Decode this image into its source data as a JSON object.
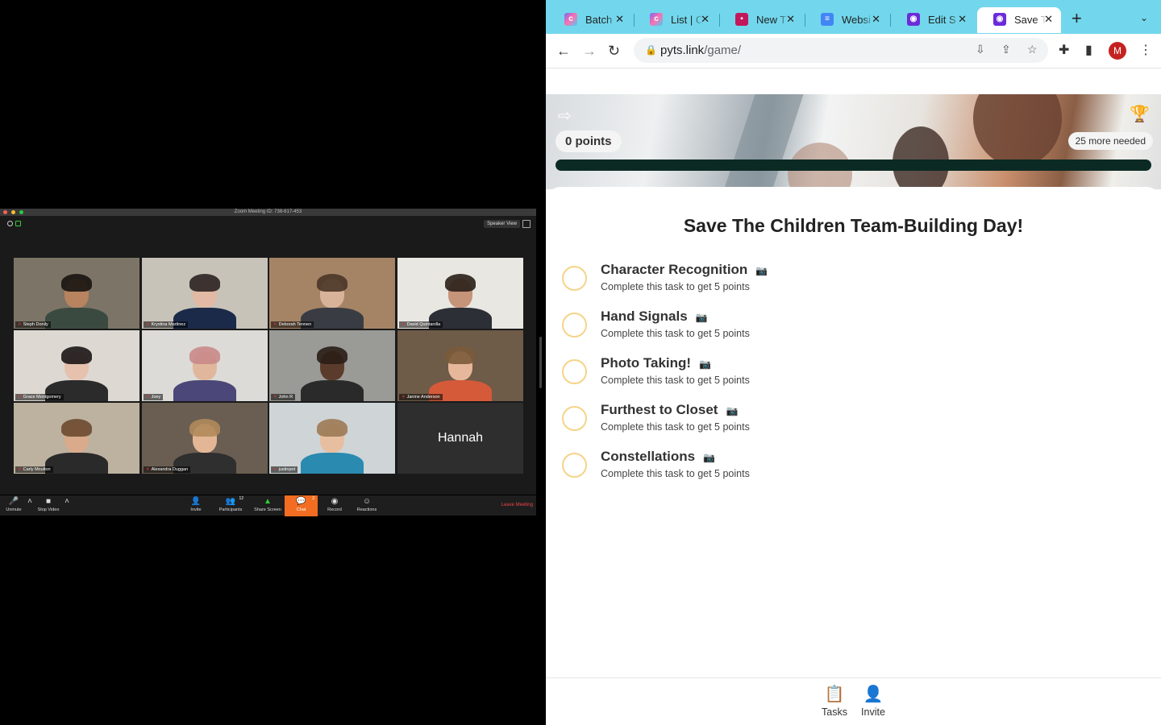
{
  "zoom": {
    "title": "Zoom Meeting ID: 738-617-453",
    "view_label": "Speaker View",
    "participants": [
      {
        "name": "Steph Donily",
        "bg": "#7c7466",
        "skin": "#b8835f",
        "shirt": "#3b4a40",
        "hair": "#1a1412"
      },
      {
        "name": "Krystina Martinez",
        "bg": "#c8c3b8",
        "skin": "#e1b9a4",
        "shirt": "#1c2a4a",
        "hair": "#2b2422"
      },
      {
        "name": "Deborah Tennen",
        "bg": "#a58466",
        "skin": "#d8b39a",
        "shirt": "#3a3c44",
        "hair": "#4a3526"
      },
      {
        "name": "David Quintanilla",
        "bg": "#e9e7e2",
        "skin": "#c69479",
        "shirt": "#2d2f36",
        "hair": "#2a1f19"
      },
      {
        "name": "Grace Montgomery",
        "bg": "#ddd9d2",
        "skin": "#e6c1ae",
        "shirt": "#2b2b2b",
        "hair": "#1a1616"
      },
      {
        "name": "Joey",
        "bg": "#dcdbd7",
        "skin": "#e0b79c",
        "shirt": "#4b4778",
        "hair": "#c98a8a"
      },
      {
        "name": "John R",
        "bg": "#9a9a96",
        "skin": "#5b3c2c",
        "shirt": "#2a2a2a",
        "hair": "#2a1d16"
      },
      {
        "name": "Janine Anderson",
        "bg": "#6e5b48",
        "skin": "#e7b79b",
        "shirt": "#d45a3a",
        "hair": "#7a5a3a"
      },
      {
        "name": "Carly Moulton",
        "bg": "#bdb2a0",
        "skin": "#d9aa8c",
        "shirt": "#2a2a2a",
        "hair": "#6b4a30"
      },
      {
        "name": "Alexandra Duggan",
        "bg": "#6a5e52",
        "skin": "#e3b796",
        "shirt": "#2f2f2f",
        "hair": "#b08a5a"
      },
      {
        "name": "justinpot",
        "bg": "#cfd4d6",
        "skin": "#e8bea0",
        "shirt": "#2a8ab0",
        "hair": "#9c7a55"
      },
      {
        "name": "Hannah"
      }
    ],
    "toolbar": {
      "unmute": "Unmute",
      "stop_video": "Stop Video",
      "invite": "Invite",
      "participants": "Participants",
      "participants_count": "12",
      "share_screen": "Share Screen",
      "chat": "Chat",
      "chat_count": "2",
      "record": "Record",
      "reactions": "Reactions",
      "leave": "Leave Meeting"
    }
  },
  "browser": {
    "tabs": [
      {
        "label": "Batch",
        "favicon": "clickup"
      },
      {
        "label": "List | C",
        "favicon": "clickup"
      },
      {
        "label": "New T",
        "favicon": "app"
      },
      {
        "label": "Websi",
        "favicon": "docs"
      },
      {
        "label": "Edit S",
        "favicon": "goosechase"
      },
      {
        "label": "Save T",
        "favicon": "goosechase",
        "active": true
      }
    ],
    "url_host": "pyts.link",
    "url_path": "/game/",
    "profile_initial": "M"
  },
  "game": {
    "points": "0 points",
    "needed": "25 more needed",
    "progress": 0,
    "title": "Save The Children Team-Building Day!",
    "tasks": [
      {
        "name": "Character Recognition",
        "description": "Complete this task to get 5 points"
      },
      {
        "name": "Hand Signals",
        "description": "Complete this task to get 5 points"
      },
      {
        "name": "Photo Taking!",
        "description": "Complete this task to get 5 points"
      },
      {
        "name": "Furthest to Closet",
        "description": "Complete this task to get 5 points"
      },
      {
        "name": "Constellations",
        "description": "Complete this task to get 5 points"
      }
    ],
    "nav": {
      "tasks": "Tasks",
      "invite": "Invite"
    }
  }
}
